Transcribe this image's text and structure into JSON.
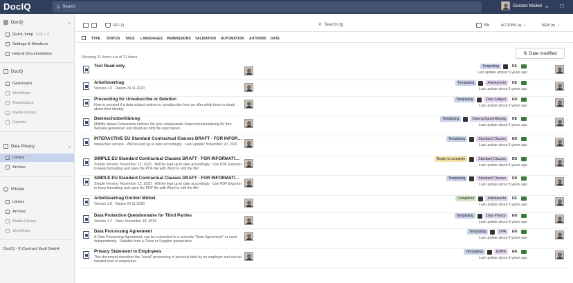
{
  "app": {
    "logo": "DocIQ",
    "search_placeholder": "Search",
    "user_name": "Gordon Mickel"
  },
  "sidebar": {
    "org": "DocIQ",
    "quick_jump": "Quick Jump",
    "quick_jump_hint": "(Ctrl + J)",
    "settings": "Settings & Members",
    "help": "Help & Documentation",
    "docIQ_section": "DocIQ",
    "dashboard": "Dashboard",
    "workflows": "Workflows",
    "marketplace": "Marketplace",
    "media_library": "Media Library",
    "reports": "Reports",
    "data_privacy_section": "Data Privacy",
    "library": "Library",
    "archive": "Archive",
    "private_section": "Private",
    "private_library": "Library",
    "private_archive": "Archive",
    "private_media": "Media Library",
    "private_workflows": "Workflows",
    "footer": "DocIQ - © Contract Vault GmbH"
  },
  "toolbar": {
    "off_label": "OFF (!)",
    "search_placeholder": "Search (q)",
    "pin": "PIN",
    "actions": "ACTIONS (a)",
    "new": "NEW (n)"
  },
  "filters": [
    "TYPE",
    "STATUS",
    "TAGS",
    "LANGUAGES",
    "PERMISSIONS",
    "VALIDATION",
    "AUTOMATION",
    "AUTHORS",
    "DATE"
  ],
  "list": {
    "count_text": "Showing 11 items out of 11 items.",
    "sort_label": "Date modified"
  },
  "rows": [
    {
      "title": "Test Read only",
      "desc": "",
      "tags": [
        {
          "type": "tpl",
          "text": "Templating"
        },
        {
          "type": "pen"
        },
        {
          "type": "lang",
          "text": "DE"
        },
        {
          "type": "plus"
        }
      ],
      "update": "Last update almost 5 years ago"
    },
    {
      "title": "Arbeitsvertrag",
      "desc": "Version 1.0 · Datum 24.11.2020",
      "tags": [
        {
          "type": "tpl",
          "text": "Templating"
        },
        {
          "type": "pen"
        },
        {
          "type": "cat",
          "text": "Arbeitsrecht"
        },
        {
          "type": "lang",
          "text": "DE"
        },
        {
          "type": "plus"
        }
      ],
      "update": "Last update about 5 years ago"
    },
    {
      "title": "Proceeding for Unsubscribe or Deletion",
      "desc": "How to proceed if a data subject wishes to unsubscribe from an offer while there is doubt about their identity.",
      "tags": [
        {
          "type": "tpl",
          "text": "Templating"
        },
        {
          "type": "pen"
        },
        {
          "type": "cat",
          "text": "Data Subject"
        },
        {
          "type": "lang",
          "text": "EN"
        },
        {
          "type": "plus"
        }
      ],
      "update": "Last update about 5 years ago"
    },
    {
      "title": "Datenschutzerklärung",
      "desc": "Mithilfe dieses Dokuments können Sie eine umfassende Datenschutzerklärung für Ihre Website generieren und direkt als html file exportieren.",
      "tags": [
        {
          "type": "tpl",
          "text": "Templating"
        },
        {
          "type": "pen"
        },
        {
          "type": "cat",
          "text": "Datenschutzerklärung"
        },
        {
          "type": "lang",
          "text": "DE"
        },
        {
          "type": "plus"
        }
      ],
      "update": "Last update about 5 years ago"
    },
    {
      "title": "INTERACTIVE EU Standard Contractual Clauses DRAFT - FOR INFORMATION ...",
      "desc": "Interactive Version · Will be kept up to date accordingly · Last Update: November 20, 2020",
      "tags": [
        {
          "type": "tpl",
          "text": "Templating"
        },
        {
          "type": "pen"
        },
        {
          "type": "cat",
          "text": "Standard Clauses"
        },
        {
          "type": "lang",
          "text": "EN"
        },
        {
          "type": "plus"
        }
      ],
      "update": "Last update about 5 years ago"
    },
    {
      "title": "SIMPLE EU Standard Contractual Clauses DRAFT - FOR INFORMATION AND ...",
      "desc": "Simple Version: November 12, 2020 · Will be kept up to date accordingly · Use PDF Exporter to keep formatting and open the PDF file with Word to edit the file!",
      "tags": [
        {
          "type": "ready",
          "text": "Ready to complete"
        },
        {
          "type": "pen"
        },
        {
          "type": "cat",
          "text": "Standard Clauses"
        },
        {
          "type": "lang",
          "text": "EN"
        },
        {
          "type": "plus"
        }
      ],
      "update": "Last update about 5 years ago"
    },
    {
      "title": "SIMPLE EU Standard Contractual Clauses DRAFT - FOR INFORMATION AND ...",
      "desc": "Simple Version: November 12, 2020 · Will be kept up to date accordingly · Use PDF Exporter to keep formatting and open the PDF file with Word to edit the file!",
      "tags": [
        {
          "type": "tpl",
          "text": "Templating"
        },
        {
          "type": "pen"
        },
        {
          "type": "cat",
          "text": "Standard Clauses"
        },
        {
          "type": "lang",
          "text": "EN"
        },
        {
          "type": "plus"
        }
      ],
      "update": "Last update about 5 years ago"
    },
    {
      "title": "Arbeitsvertrag Gordon Mickel",
      "desc": "Version 1.0 · Datum 24.11.2020",
      "tags": [
        {
          "type": "ok",
          "text": "Completed"
        },
        {
          "type": "pen"
        },
        {
          "type": "cat",
          "text": "Arbeitsrecht"
        },
        {
          "type": "lang",
          "text": "DE"
        },
        {
          "type": "plus"
        }
      ],
      "update": "Last update about 5 years ago"
    },
    {
      "title": "Data Protection Questionnaire for Third Parties",
      "desc": "Version 1.2 · Date: November 18, 2020",
      "tags": [
        {
          "type": "tpl",
          "text": "Templating"
        },
        {
          "type": "pen"
        },
        {
          "type": "cat",
          "text": "Data Privacy"
        },
        {
          "type": "lang",
          "text": "EN"
        },
        {
          "type": "plus"
        }
      ],
      "update": "Last update about 5 years ago"
    },
    {
      "title": "Data Processing Agreement",
      "desc": "A Data Processing Agreement, can be connected to a concrete \"Main Agreement\" or used independently · Suitable from a Client or Supplier perspective.",
      "tags": [
        {
          "type": "tpl",
          "text": "Templating"
        },
        {
          "type": "pen"
        },
        {
          "type": "cat",
          "text": "DPA"
        },
        {
          "type": "lang",
          "text": "EN"
        },
        {
          "type": "plus"
        }
      ],
      "update": "Last update about 5 years ago"
    },
    {
      "title": "Privacy Statement to Employees",
      "desc": "This document describes the \"usual\" processing of personal data by an employer and can be handed over to employees",
      "tags": [
        {
          "type": "tpl",
          "text": "Templating"
        },
        {
          "type": "pen"
        },
        {
          "type": "cat",
          "text": "GDPR"
        },
        {
          "type": "lang",
          "text": "EN"
        },
        {
          "type": "plus"
        }
      ],
      "update": "Last update about 5 years ago"
    }
  ]
}
